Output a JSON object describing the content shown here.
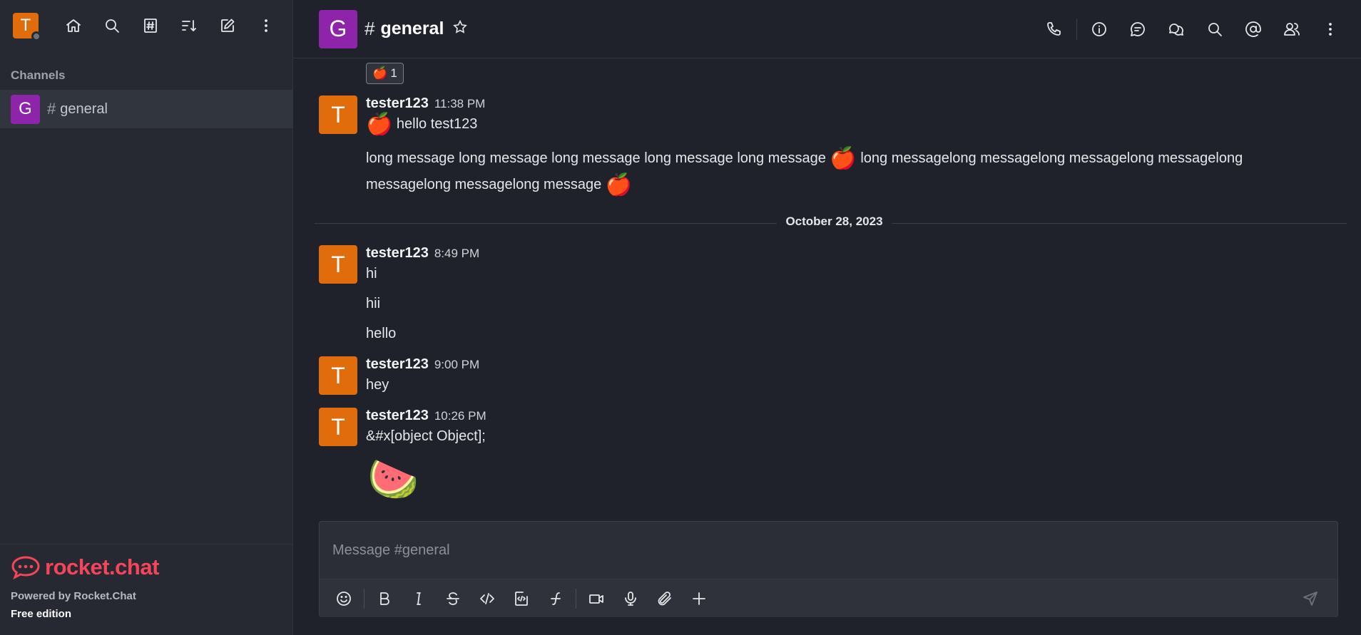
{
  "user": {
    "initial": "T"
  },
  "sidebar": {
    "section_title": "Channels",
    "channel": {
      "initial": "G",
      "name": "general"
    },
    "footer": {
      "logo_text": "rocket.chat",
      "powered": "Powered by Rocket.Chat",
      "edition": "Free edition"
    }
  },
  "header": {
    "room_initial": "G",
    "room_name": "general"
  },
  "reaction": {
    "emoji": "🍎",
    "count": "1"
  },
  "messages": [
    {
      "user": "tester123",
      "initial": "T",
      "time": "11:38 PM",
      "lines": [
        "hello test123",
        "long message long message long message long message long message",
        "long messagelong messagelong messagelong messagelong",
        "messagelong messagelong message"
      ]
    },
    {
      "user": "tester123",
      "initial": "T",
      "time": "8:49 PM",
      "lines": [
        "hi",
        "hii",
        "hello"
      ]
    },
    {
      "user": "tester123",
      "initial": "T",
      "time": "9:00 PM",
      "lines": [
        "hey"
      ]
    },
    {
      "user": "tester123",
      "initial": "T",
      "time": "10:26 PM",
      "lines": [
        "&#x[object Object];"
      ]
    }
  ],
  "emojis": {
    "apple": "🍎",
    "watermelon": "🍉"
  },
  "date_divider": "October 28, 2023",
  "composer": {
    "placeholder": "Message #general"
  },
  "colors": {
    "avatar_user": "#e06c0c",
    "avatar_room": "#8e24aa",
    "brand": "#f5455c"
  }
}
